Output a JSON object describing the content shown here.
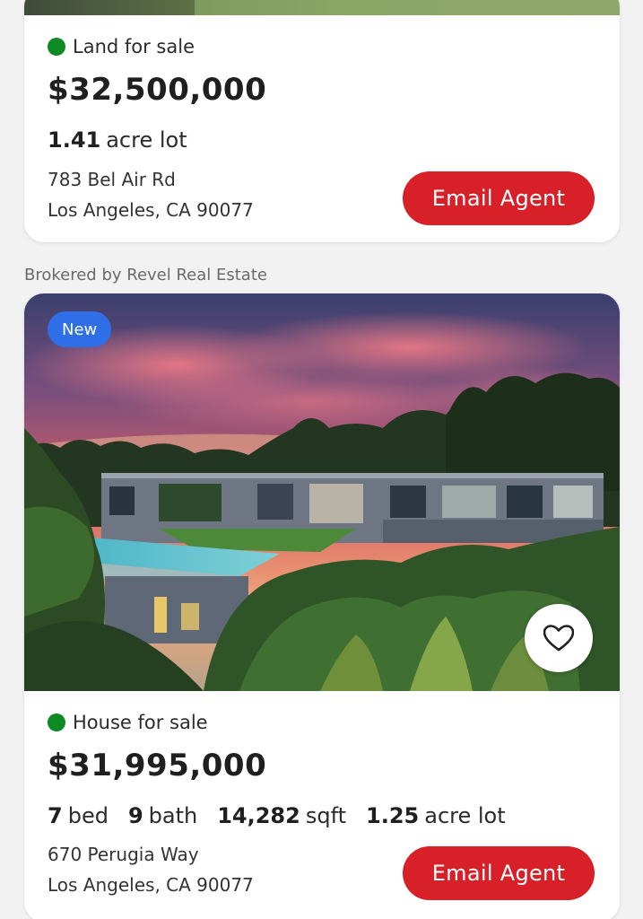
{
  "listings": [
    {
      "status": "Land for sale",
      "status_color": "#0e8a24",
      "price": "$32,500,000",
      "lot_value": "1.41",
      "lot_unit": "acre lot",
      "address_line1": "783 Bel Air Rd",
      "address_line2": "Los Angeles, CA 90077",
      "cta": "Email Agent"
    },
    {
      "broker": "Brokered by Revel Real Estate",
      "badge": "New",
      "status": "House for sale",
      "status_color": "#0e8a24",
      "price": "$31,995,000",
      "beds_value": "7",
      "beds_unit": "bed",
      "baths_value": "9",
      "baths_unit": "bath",
      "sqft_value": "14,282",
      "sqft_unit": "sqft",
      "lot_value": "1.25",
      "lot_unit": "acre lot",
      "address_line1": "670 Perugia Way",
      "address_line2": "Los Angeles, CA 90077",
      "cta": "Email Agent",
      "favorite_icon": "heart-outline-icon"
    }
  ],
  "colors": {
    "accent_red": "#d72028",
    "badge_blue": "#2e6fe8",
    "status_green": "#0e8a24"
  }
}
